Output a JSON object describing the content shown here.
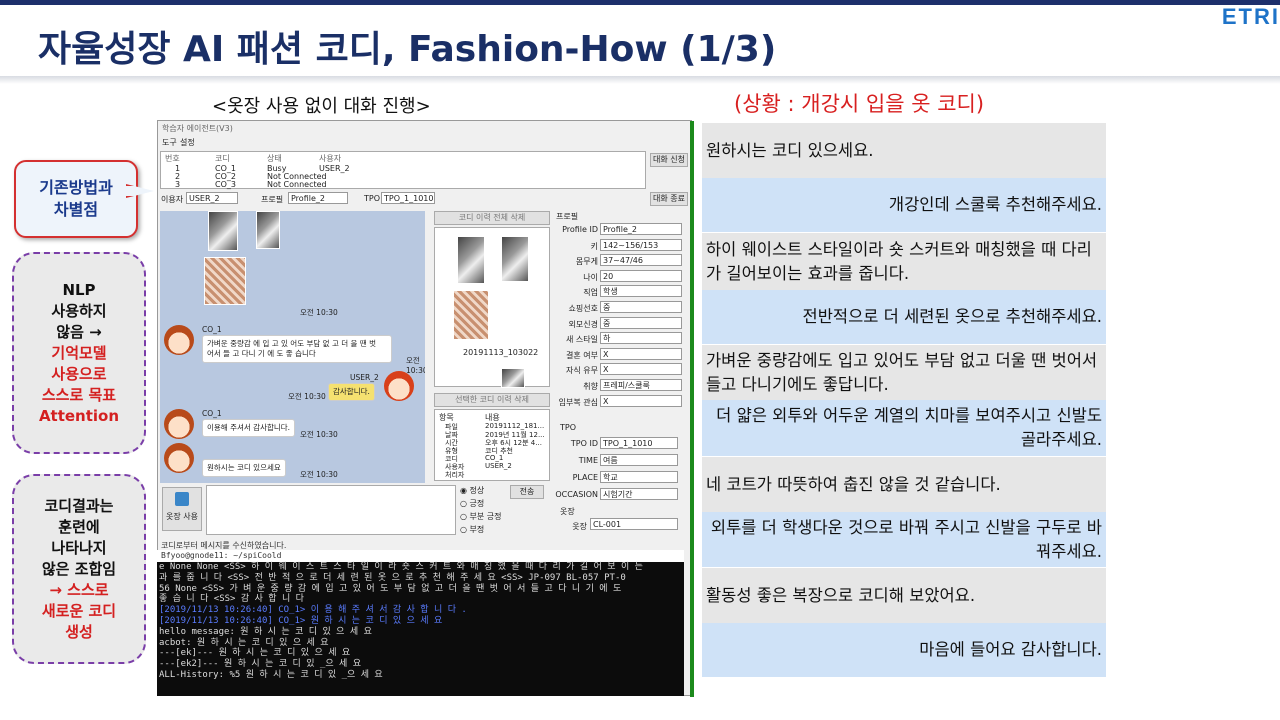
{
  "brand": "ETRI",
  "title": "자율성장 AI 패션 코디, Fashion-How (1/3)",
  "subtitle": "<옷장 사용 없이 대화 진행>",
  "situation": "(상황 : 개강시 입을 옷 코디)",
  "callout": {
    "line1": "기존방법과",
    "line2": "차별점"
  },
  "box1": {
    "l1": "NLP",
    "l2": "사용하지",
    "l3": "않음 →",
    "l4": "기억모델",
    "l5": "사용으로",
    "l6": "스스로 목표",
    "l7": "Attention"
  },
  "box2": {
    "l1": "코디결과는",
    "l2": "훈련에",
    "l3": "나타나지",
    "l4": "않은 조합임",
    "l5": "→ 스스로",
    "l6": "새로운 코디",
    "l7": "생성"
  },
  "window": {
    "title": "학습자 에이전트(V3)",
    "menu": [
      "도구",
      "설정"
    ],
    "table_headers": [
      "번호",
      "코디",
      "상태",
      "사용자"
    ],
    "rows": [
      [
        "1",
        "CO_1",
        "Busy",
        "USER_2"
      ],
      [
        "2",
        "CO_2",
        "Not Connected",
        ""
      ],
      [
        "3",
        "CO_3",
        "Not Connected",
        ""
      ]
    ],
    "connect_btn": "대화 신청",
    "end_btn": "대화 종료",
    "user_label": "이용자",
    "user_value": "USER_2",
    "profile_label": "프로필",
    "profile_value": "Profile_2",
    "tpo_label": "TPO",
    "tpo_value": "TPO_1_1010",
    "chat": {
      "time1": "오전 10:30",
      "name_co": "CO_1",
      "msg1a": "가벼운 중량감 에 입 고 있 어도 부담 없 고 더 을 땐 벗",
      "msg1b": "어서 들 고 다니 기 에 도 좋 습니다",
      "time2": "오전 10:30",
      "name_user": "USER_2",
      "msg2": "감사합니다.",
      "time3": "오전 10:30",
      "msg3": "이용해 주셔서 감사합니다.",
      "time4": "오전 10:30",
      "msg4": "원하시는 코디 있으세요",
      "time5": "오전 10:30"
    },
    "wardrobe_btn": "옷장 사용",
    "ratings": [
      "정상",
      "긍정",
      "부분 긍정",
      "부정"
    ],
    "send_btn": "전송",
    "status_text": "코디로부터 메시지를 수신하였습니다.",
    "delete_all_btn": "코디 이력 전체 삭제",
    "coordi_id": "20191113_103022",
    "delete_sel_btn": "선택한 코디 이력 삭제",
    "history_headers": [
      "항목",
      "내용"
    ],
    "history": [
      [
        "파일",
        "20191112_181..."
      ],
      [
        "날짜",
        "2019년 11월 12..."
      ],
      [
        "시간",
        "오후 6시 12분 4..."
      ],
      [
        "유형",
        "코디 추천"
      ],
      [
        "코디",
        "CO_1"
      ],
      [
        "사용자",
        "USER_2"
      ],
      [
        "처리자",
        ""
      ]
    ],
    "profile_section": "프로필",
    "profile_fields": [
      [
        "Profile ID",
        "Profile_2"
      ],
      [
        "키",
        "142~156/153"
      ],
      [
        "몸무게",
        "37~47/46"
      ],
      [
        "나이",
        "20"
      ],
      [
        "직업",
        "학생"
      ],
      [
        "쇼핑선호",
        "중"
      ],
      [
        "외모신경",
        "중"
      ],
      [
        "새 스타일",
        "하"
      ],
      [
        "결혼 여부",
        "X"
      ],
      [
        "자식 유무",
        "X"
      ],
      [
        "취향",
        "프레피/스쿨룩"
      ],
      [
        "임부복 관심",
        "X"
      ]
    ],
    "tpo_section": "TPO",
    "tpo_fields": [
      [
        "TPO ID",
        "TPO_1_1010"
      ],
      [
        "TIME",
        "여름"
      ],
      [
        "PLACE",
        "학교"
      ],
      [
        "OCCASION",
        "시험기간"
      ]
    ],
    "closet_section": "옷장",
    "closet_field": [
      "옷장 ID",
      "CL-001"
    ]
  },
  "console": {
    "title": "Bfyoo@gnode11: ~/spiCoold",
    "lines": [
      "e None None <SS> 하 이 웨 이 스 트  스 타 일 이 라  숏  스 커 트 와  매 칭 했 을  때  다 리 가  길 어  보 이 는",
      "과 를  줍 니 다  <SS> 전 반 적 으 로  더  세 련 된  옷 으 로  추 천 해  주 세 요  <SS> JP-097 BL-057 PT-0",
      "56 None <SS> 가 벼 운  중 량 감 에  입 고 있 어 도  부 담 없 고  더 을  땐  벗 어 서  들 고  다 니 기 에  도",
      "좋 습 니 다  <SS> 감 사 합 니 다",
      "[2019/11/13 10:26:40] CO_1> 이 용 해  주 셔 서  감 사 합 니 다 .",
      "[2019/11/13 10:26:40] CO_1> 원 하 시 는  코 디  있 으 세 요",
      "hello message: 원 하 시 는  코 디  있 으 세 요",
      "acbot: 원 하 시 는  코 디  있 으 세 요",
      "---[ek]--- 원 하 시 는  코 디  있 으 세 요",
      "---[ek2]--- 원 하 시 는  코 디  있 _으 세  요",
      "ALL-History: %5 원 하  시 는  코 디  있 _으 세  요"
    ]
  },
  "dialogue": [
    {
      "role": "system",
      "text": "원하시는 코디 있으세요."
    },
    {
      "role": "user",
      "text": "개강인데 스쿨룩 추천해주세요."
    },
    {
      "role": "system",
      "text": "하이 웨이스트 스타일이라 숏 스커트와 매칭했을 때 다리가 길어보이는 효과를 줍니다."
    },
    {
      "role": "user",
      "text": "전반적으로 더 세련된 옷으로 추천해주세요."
    },
    {
      "role": "system",
      "text": "가벼운 중량감에도 입고 있어도 부담 없고 더울 땐 벗어서 들고 다니기에도 좋답니다."
    },
    {
      "role": "user",
      "text": "더 얇은 외투와 어두운 계열의 치마를 보여주시고 신발도 골라주세요."
    },
    {
      "role": "system",
      "text": "네 코트가 따뜻하여 춥진 않을 것 같습니다."
    },
    {
      "role": "user",
      "text": "외투를 더 학생다운 것으로 바꿔 주시고 신발을 구두로 바꿔주세요."
    },
    {
      "role": "system",
      "text": "활동성 좋은 복장으로 코디해 보았어요."
    },
    {
      "role": "user",
      "text": "마음에 들어요 감사합니다."
    }
  ]
}
